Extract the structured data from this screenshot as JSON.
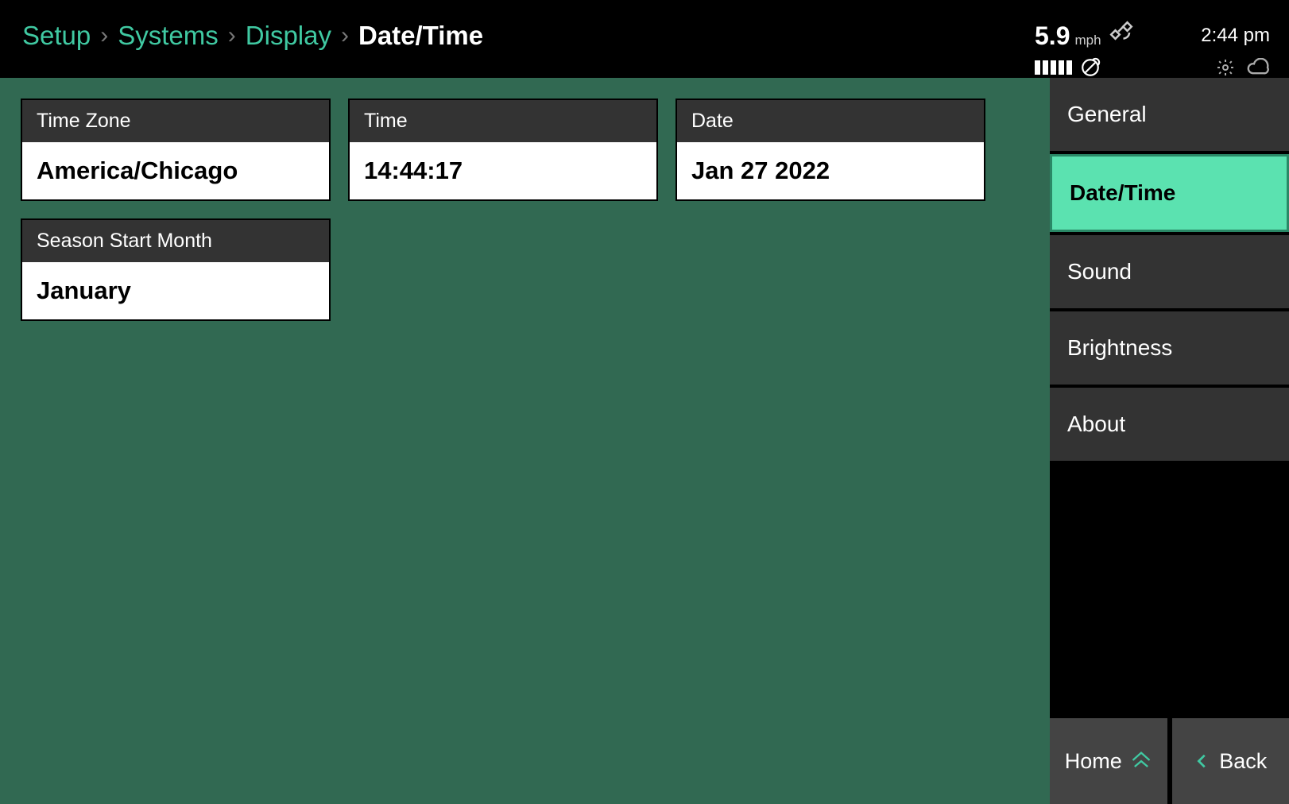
{
  "breadcrumbs": {
    "items": [
      "Setup",
      "Systems",
      "Display"
    ],
    "current": "Date/Time"
  },
  "status": {
    "speed_value": "5.9",
    "speed_unit": "mph",
    "clock": "2:44 pm"
  },
  "cards": {
    "time_zone": {
      "label": "Time Zone",
      "value": "America/Chicago"
    },
    "time": {
      "label": "Time",
      "value": "14:44:17"
    },
    "date": {
      "label": "Date",
      "value": "Jan 27 2022"
    },
    "season": {
      "label": "Season Start Month",
      "value": "January"
    }
  },
  "sidebar": {
    "items": [
      {
        "label": "General",
        "active": false
      },
      {
        "label": "Date/Time",
        "active": true
      },
      {
        "label": "Sound",
        "active": false
      },
      {
        "label": "Brightness",
        "active": false
      },
      {
        "label": "About",
        "active": false
      }
    ]
  },
  "bottom": {
    "home": "Home",
    "back": "Back"
  }
}
